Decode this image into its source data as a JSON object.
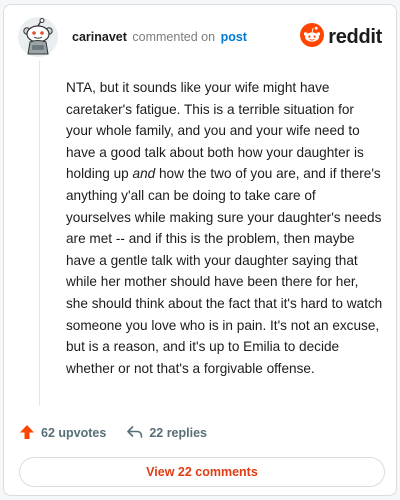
{
  "header": {
    "username": "carinavet",
    "action_text": "commented on",
    "target_text": "post",
    "brand": "reddit"
  },
  "comment": {
    "part1": "NTA, but it sounds like your wife might have caretaker's fatigue. This is a terrible situation for your whole family, and you and your wife need to have a good talk about both how your daughter is holding up ",
    "emphasis": "and",
    "part2": " how the two of you are, and if there's anything y'all can be doing to take care of yourselves while making sure your daughter's needs are met -- and if this is the problem, then maybe have a gentle talk with your daughter saying that while her mother should have been there for her, she should think about the fact that it's hard to watch someone you love who is in pain. It's not an excuse, but is a reason, and it's up to Emilia to decide whether or not that's a forgivable offense."
  },
  "actions": {
    "upvotes": "62 upvotes",
    "replies": "22 replies",
    "view_comments": "View 22 comments"
  },
  "colors": {
    "upvote": "#ff4500",
    "link": "#0079d3",
    "view_button_text": "#e03c14"
  },
  "icons": {
    "avatar": "snoo-avatar",
    "brand": "reddit-logo-icon",
    "upvote": "upvote-arrow-icon",
    "reply": "reply-arrow-icon"
  }
}
